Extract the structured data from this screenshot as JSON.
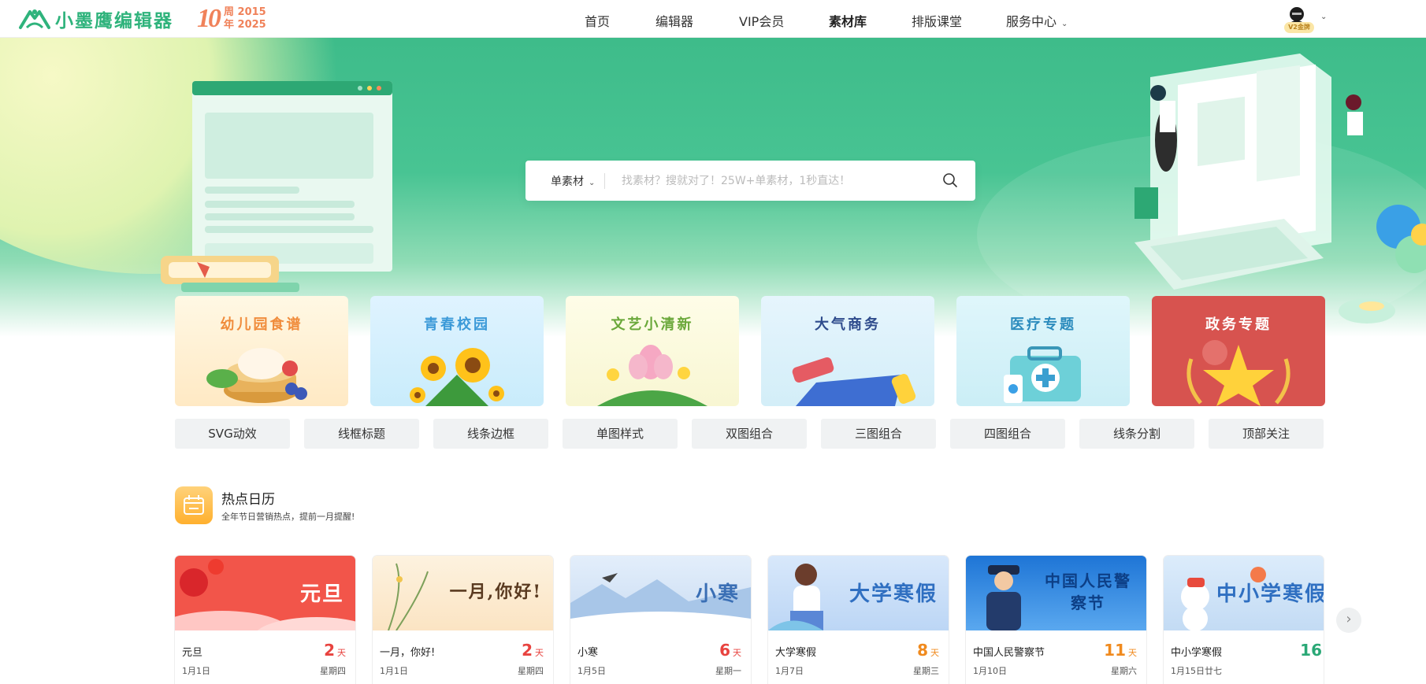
{
  "header": {
    "brand": "小墨鹰编辑器",
    "anniversary": {
      "number": "10",
      "line1": "周 2015",
      "line2": "年 2025"
    },
    "nav": [
      {
        "label": "首页"
      },
      {
        "label": "编辑器"
      },
      {
        "label": "VIP会员"
      },
      {
        "label": "素材库"
      },
      {
        "label": "排版课堂"
      },
      {
        "label": "服务中心"
      }
    ],
    "user_badge": "V2金牌"
  },
  "search": {
    "type_label": "单素材",
    "placeholder": "找素材？搜就对了！25W+单素材，1秒直达！"
  },
  "topics": [
    {
      "title": "幼儿园食谱",
      "color": "#f08c3c",
      "bg": "#fff4df"
    },
    {
      "title": "青春校园",
      "color": "#3c9ad8",
      "bg": "#e3f6ff"
    },
    {
      "title": "文艺小清新",
      "color": "#6aa83a",
      "bg": "#fcfbe1"
    },
    {
      "title": "大气商务",
      "color": "#2e4b8c",
      "bg": "#e9f6fd"
    },
    {
      "title": "医疗专题",
      "color": "#2b8bbd",
      "bg": "#e2f7fb"
    },
    {
      "title": "政务专题",
      "color": "#ffffff",
      "bg": "#d7534f"
    }
  ],
  "chips": [
    "SVG动效",
    "线框标题",
    "线条边框",
    "单图样式",
    "双图组合",
    "三图组合",
    "四图组合",
    "线条分割",
    "顶部关注"
  ],
  "calendar": {
    "title": "热点日历",
    "subtitle": "全年节日营销热点，提前一月提醒!",
    "day_unit": "天",
    "events": [
      {
        "img_text": "元旦",
        "name": "元旦",
        "date": "1月1日",
        "days": "2",
        "weekday": "星期四",
        "days_color": "#e8433f",
        "bg": "linear-gradient(180deg,#f04a3c,#f9767a 70%,#ffd7d5)",
        "img_text_color": "#ffffff"
      },
      {
        "img_text": "一月,你好!",
        "name": "一月，你好!",
        "date": "1月1日",
        "days": "2",
        "weekday": "星期四",
        "days_color": "#e8433f",
        "bg": "linear-gradient(180deg,#fdf2df,#fbe4c3)",
        "img_text_color": "#5a3a20"
      },
      {
        "img_text": "小寒",
        "name": "小寒",
        "date": "1月5日",
        "days": "6",
        "weekday": "星期一",
        "days_color": "#e8433f",
        "bg": "linear-gradient(180deg,#e3eefb,#c9dcf2)",
        "img_text_color": "#3a6fb5"
      },
      {
        "img_text": "大学寒假",
        "name": "大学寒假",
        "date": "1月7日",
        "days": "8",
        "weekday": "星期三",
        "days_color": "#f08a1e",
        "bg": "linear-gradient(180deg,#d8e8fb,#bcd6f5)",
        "img_text_color": "#2f6fc1"
      },
      {
        "img_text": "中国人民警察节",
        "name": "中国人民警察节",
        "date": "1月10日",
        "days": "11",
        "weekday": "星期六",
        "days_color": "#f08a1e",
        "bg": "linear-gradient(180deg,#1e75d6,#5aa8ef)",
        "img_text_color": "#0d3f86"
      },
      {
        "img_text": "中小学寒假",
        "name": "中小学寒假",
        "date": "1月15日廿七",
        "days": "16",
        "weekday": "",
        "days_color": "#2aa876",
        "bg": "linear-gradient(180deg,#dcecfb,#c3dbf4)",
        "img_text_color": "#2f6fc1"
      }
    ]
  }
}
